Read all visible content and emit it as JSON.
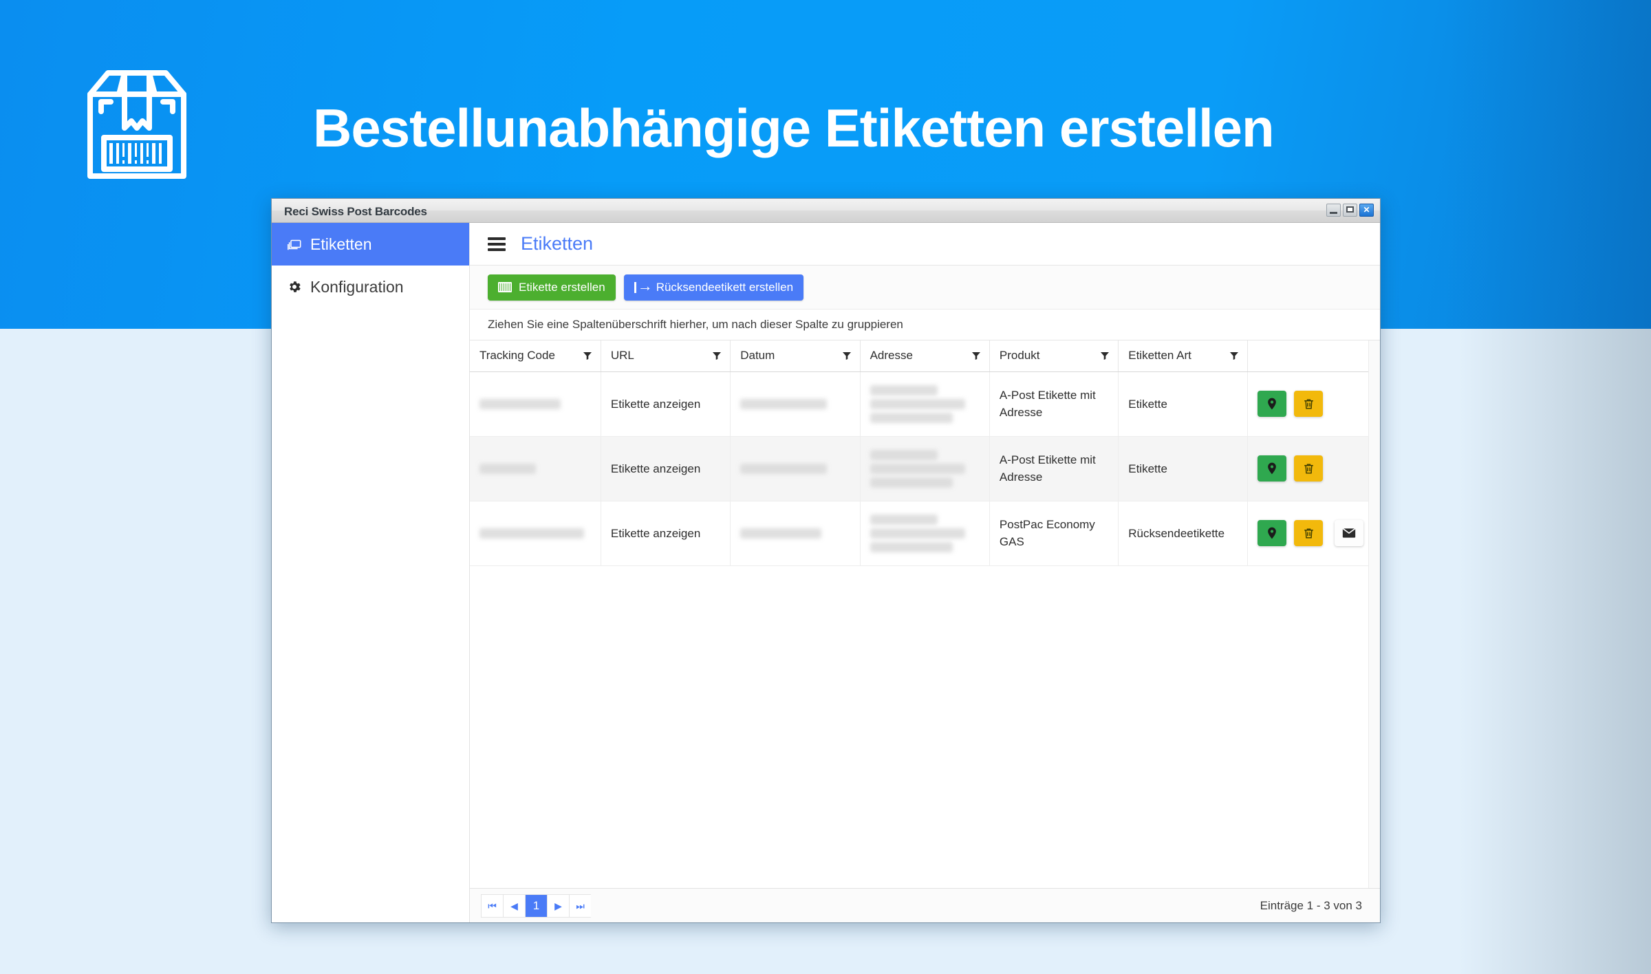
{
  "banner": {
    "title": "Bestellunabhängige Etiketten erstellen",
    "logo_icon": "package-barcode-icon",
    "bg_color": "#0a9cf7",
    "title_color": "#ffffff"
  },
  "page": {
    "bg_color": "#e2f0fb"
  },
  "window": {
    "title": "Reci Swiss Post Barcodes",
    "controls": {
      "minimize_icon": "minimize-icon",
      "maximize_icon": "maximize-icon",
      "close_label": "✕"
    }
  },
  "sidebar": {
    "items": [
      {
        "label": "Etiketten",
        "icon": "labels-icon",
        "active": true
      },
      {
        "label": "Konfiguration",
        "icon": "gear-icon",
        "active": false
      }
    ]
  },
  "content": {
    "menu_icon": "hamburger-icon",
    "title": "Etiketten",
    "title_color": "#4a7bf7"
  },
  "toolbar": {
    "create_label": "Etikette erstellen",
    "create_icon": "barcode-icon",
    "create_color": "#4caf2f",
    "return_label": "Rücksendeetikett erstellen",
    "return_icon": "return-arrow-icon",
    "return_color": "#4a7bf7"
  },
  "grid": {
    "group_hint": "Ziehen Sie eine Spaltenüberschrift hierher, um nach dieser Spalte zu gruppieren",
    "columns": [
      {
        "label": "Tracking Code",
        "filter_icon": "filter-icon"
      },
      {
        "label": "URL",
        "filter_icon": "filter-icon"
      },
      {
        "label": "Datum",
        "filter_icon": "filter-icon"
      },
      {
        "label": "Adresse",
        "filter_icon": "filter-icon"
      },
      {
        "label": "Produkt",
        "filter_icon": "filter-icon"
      },
      {
        "label": "Etiketten Art",
        "filter_icon": "filter-icon"
      },
      {
        "label": "",
        "filter_icon": ""
      }
    ],
    "rows": [
      {
        "tracking_code": "",
        "tracking_code_redacted": true,
        "url": "Etikette anzeigen",
        "datum": "",
        "datum_redacted": true,
        "adresse": "",
        "adresse_redacted": true,
        "produkt": "A-Post Etikette mit Adresse",
        "etiketten_art": "Etikette",
        "actions": [
          "track-icon",
          "delete-icon"
        ]
      },
      {
        "tracking_code": "",
        "tracking_code_redacted": true,
        "url": "Etikette anzeigen",
        "datum": "",
        "datum_redacted": true,
        "adresse": "",
        "adresse_redacted": true,
        "produkt": "A-Post Etikette mit Adresse",
        "etiketten_art": "Etikette",
        "actions": [
          "track-icon",
          "delete-icon"
        ]
      },
      {
        "tracking_code": "",
        "tracking_code_redacted": true,
        "url": "Etikette anzeigen",
        "datum": "",
        "datum_redacted": true,
        "adresse": "",
        "adresse_redacted": true,
        "produkt": "PostPac Economy GAS",
        "etiketten_art": "Rücksendeetikette",
        "actions": [
          "track-icon",
          "delete-icon",
          "email-icon"
        ]
      }
    ]
  },
  "pager": {
    "first_label": "⏮",
    "prev_label": "◀",
    "current_page": "1",
    "next_label": "▶",
    "last_label": "⏭",
    "info": "Einträge 1 - 3 von 3"
  }
}
